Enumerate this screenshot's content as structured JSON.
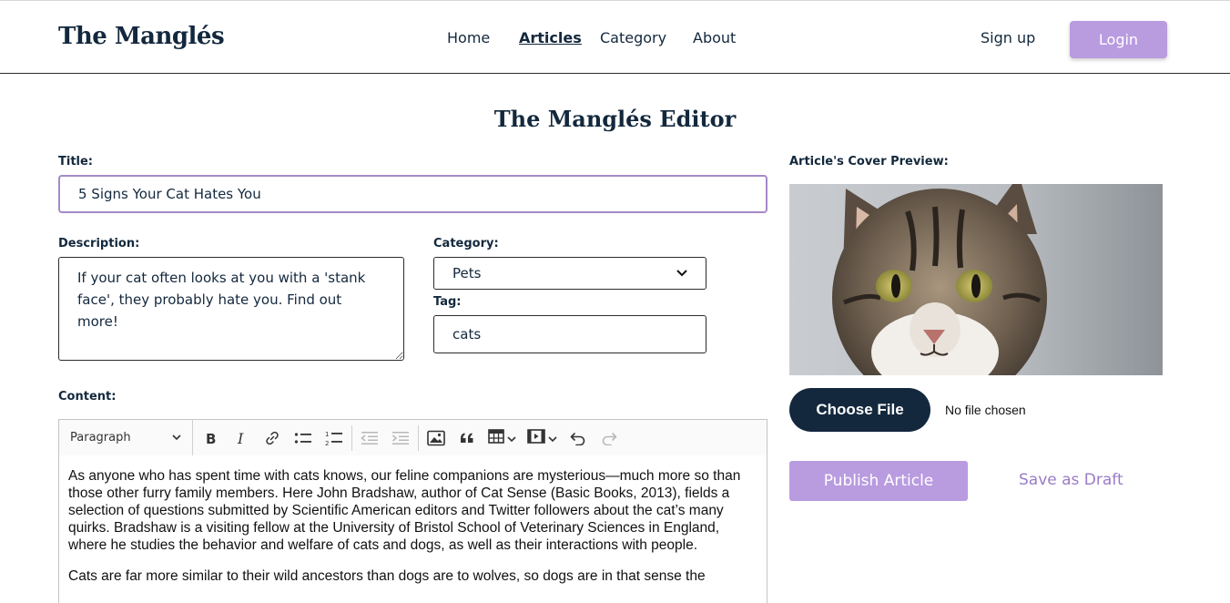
{
  "header": {
    "brand": "The Manglés",
    "nav": [
      "Home",
      "Articles",
      "Category",
      "About"
    ],
    "signup_label": "Sign up",
    "login_label": "Login"
  },
  "page_title": "The Manglés Editor",
  "form": {
    "title_label": "Title:",
    "title_value": "5 Signs Your Cat Hates You",
    "description_label": "Description:",
    "description_value": "If your cat often looks at you with a 'stank face', they probably hate you. Find out more!",
    "category_label": "Category:",
    "category_value": "Pets",
    "tag_label": "Tag:",
    "tag_value": "cats",
    "content_label": "Content:"
  },
  "toolbar": {
    "paragraph_label": "Paragraph",
    "buttons": [
      "bold-icon",
      "italic-icon",
      "link-icon",
      "bulleted-list-icon",
      "numbered-list-icon",
      "outdent-icon",
      "indent-icon",
      "image-icon",
      "quote-icon",
      "table-icon",
      "media-icon",
      "undo-icon",
      "redo-icon"
    ]
  },
  "content": {
    "paragraphs": [
      "As anyone who has spent time with cats knows, our feline companions are mysterious—much more so than those other furry family members. Here John Bradshaw, author of Cat Sense (Basic Books, 2013), fields a selection of questions submitted by Scientific American editors and Twitter followers about the cat’s many quirks. Bradshaw is a visiting fellow at the University of Bristol School of Veterinary Sciences in England, where he studies the behavior and welfare of cats and dogs, as well as their interactions with people.",
      "Cats are far more similar to their wild ancestors than dogs are to wolves, so dogs are in that sense the"
    ]
  },
  "cover": {
    "label": "Article's Cover Preview:",
    "choose_file_label": "Choose File",
    "no_file_text": "No file chosen"
  },
  "actions": {
    "publish_label": "Publish Article",
    "draft_label": "Save as Draft"
  },
  "colors": {
    "navy": "#13283d",
    "lavender": "#b99be0",
    "draft_purple": "#9a7bc8"
  }
}
